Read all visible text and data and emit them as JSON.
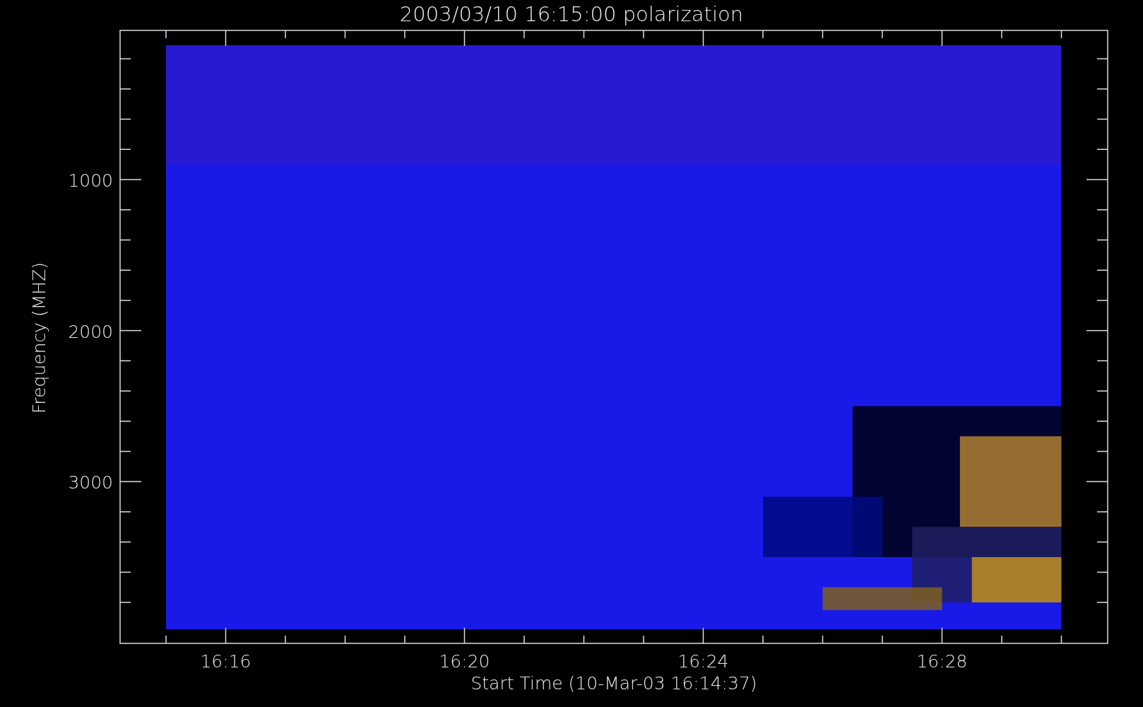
{
  "title": "2003/03/10 16:15:00 polarization",
  "ylabel": "Frequency (MHZ)",
  "xlabel": "Start Time (10-Mar-03 16:14:37)",
  "yticks": [
    "1000",
    "2000",
    "3000"
  ],
  "xticks": [
    "16:16",
    "16:20",
    "16:24",
    "16:28"
  ]
}
